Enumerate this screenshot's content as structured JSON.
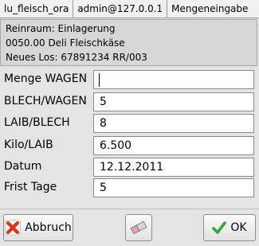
{
  "titlebar": {
    "module": "lu_fleisch_ora",
    "user": "admin@127.0.0.1",
    "screen": "Mengeneingabe"
  },
  "info": {
    "line1": "Reinraum: Einlagerung",
    "line2": "0050.00 Deli Fleischkäse",
    "line3": "Neues Los: 67891234 RR/003"
  },
  "form": {
    "menge_wagen": {
      "label": "Menge WAGEN",
      "value": ""
    },
    "blech_wagen": {
      "label": "BLECH/WAGEN",
      "value": "5"
    },
    "laib_blech": {
      "label": "LAIB/BLECH",
      "value": "8"
    },
    "kilo_laib": {
      "label": "Kilo/LAIB",
      "value": "6.500"
    },
    "datum": {
      "label": "Datum",
      "value": "12.12.2011"
    },
    "frist_tage": {
      "label": "Frist Tage",
      "value": "5"
    }
  },
  "buttons": {
    "cancel": {
      "label": "Abbruch",
      "icon": "x-icon"
    },
    "erase": {
      "icon": "eraser-icon"
    },
    "ok": {
      "label": "OK",
      "icon": "checkmark-icon"
    }
  },
  "colors": {
    "cancel_icon": "#e0301e",
    "ok_icon": "#3aa63a"
  }
}
